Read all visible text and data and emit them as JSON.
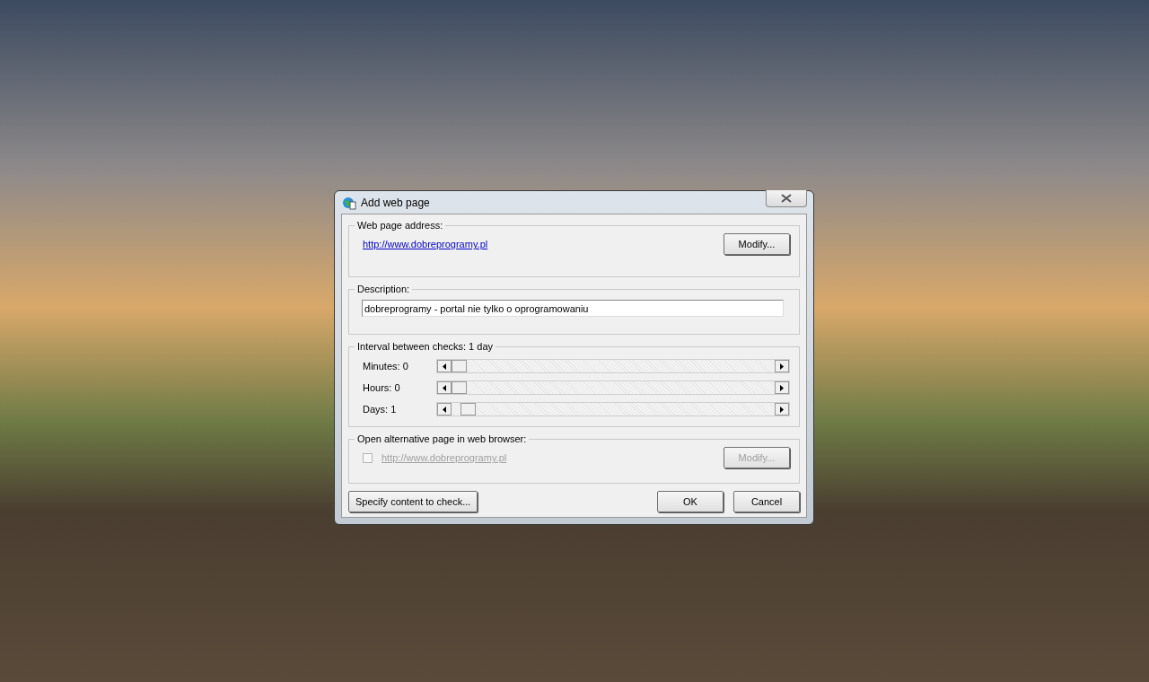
{
  "window": {
    "title": "Add web page"
  },
  "address": {
    "legend": "Web page address:",
    "url": "http://www.dobreprogramy.pl",
    "button": "Modify..."
  },
  "description": {
    "legend": "Description:",
    "value": "dobreprogramy - portal nie tylko o oprogramowaniu"
  },
  "interval": {
    "legend": "Interval between checks: 1 day",
    "sliders": [
      {
        "label": "Minutes: 0",
        "level": 0
      },
      {
        "label": "Hours: 0",
        "level": 0
      },
      {
        "label": "Days: 1",
        "level": 0.03
      }
    ]
  },
  "alternative": {
    "legend": "Open alternative page in web browser:",
    "checked": false,
    "disabled": true,
    "url": "http://www.dobreprogramy.pl",
    "button": "Modify..."
  },
  "buttons": [
    {
      "label": "Specify content to check...",
      "kind": "left"
    },
    {
      "label": "OK",
      "kind": "right"
    },
    {
      "label": "Cancel",
      "kind": "right"
    }
  ]
}
